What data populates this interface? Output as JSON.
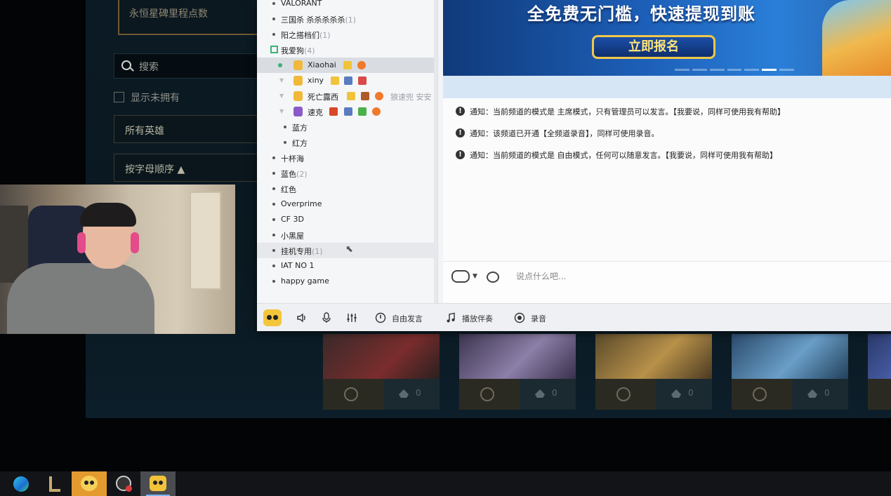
{
  "lol": {
    "mastery_label": "永恒星碑里程点数",
    "search_placeholder": "搜索",
    "show_unowned_label": "显示未拥有",
    "filter_all_champions": "所有英雄",
    "sort_label": "按字母顺序 ▲",
    "champion_cards": [
      {
        "count": "0"
      },
      {
        "count": "0"
      },
      {
        "count": "0"
      },
      {
        "count": "0"
      }
    ]
  },
  "yy": {
    "channels": [
      {
        "name": "VALORANT",
        "count": ""
      },
      {
        "name": "三国杀 杀杀杀杀杀",
        "count": "(1)"
      },
      {
        "name": "阳之搭档们",
        "count": "(1)"
      },
      {
        "name": "我爱狗",
        "count": "(4)"
      }
    ],
    "users": [
      {
        "name": "Xiaohai",
        "extra": ""
      },
      {
        "name": "xiny",
        "extra": ""
      },
      {
        "name": "死亡露西",
        "extra": "狼速兜 安安"
      },
      {
        "name": "速克",
        "extra": ""
      }
    ],
    "subchannels": [
      "蓝方",
      "红方"
    ],
    "more_channels": [
      {
        "name": "十杯海",
        "count": ""
      },
      {
        "name": "蓝色",
        "count": "(2)"
      },
      {
        "name": "红色",
        "count": ""
      },
      {
        "name": "Overprime",
        "count": ""
      },
      {
        "name": "CF 3D",
        "count": ""
      },
      {
        "name": "小黑屋",
        "count": ""
      },
      {
        "name": "挂机专用",
        "count": "(1)"
      },
      {
        "name": "IAT NO 1",
        "count": ""
      },
      {
        "name": "happy game",
        "count": ""
      }
    ],
    "banner": {
      "title": "全免费无门槛，快速提现到账",
      "button": "立即报名"
    },
    "messages": [
      "通知：当前频道的模式是 主席模式，只有管理员可以发言。【我要说，同样可使用我有帮助】",
      "通知：该频道已开通【全频道录音】，同样可使用录音。",
      "通知：当前频道的模式是 自由模式，任何可以随意发言。【我要说，同样可使用我有帮助】"
    ],
    "chat_placeholder": "说点什么吧...",
    "toolbar": {
      "free_speak": "自由发言",
      "play_music": "播放伴奏",
      "record": "录音"
    }
  },
  "colors": {
    "yy_accent": "#f3c53a",
    "lol_gold": "#c8aa6e",
    "banner_blue": "#1d5fb8"
  }
}
